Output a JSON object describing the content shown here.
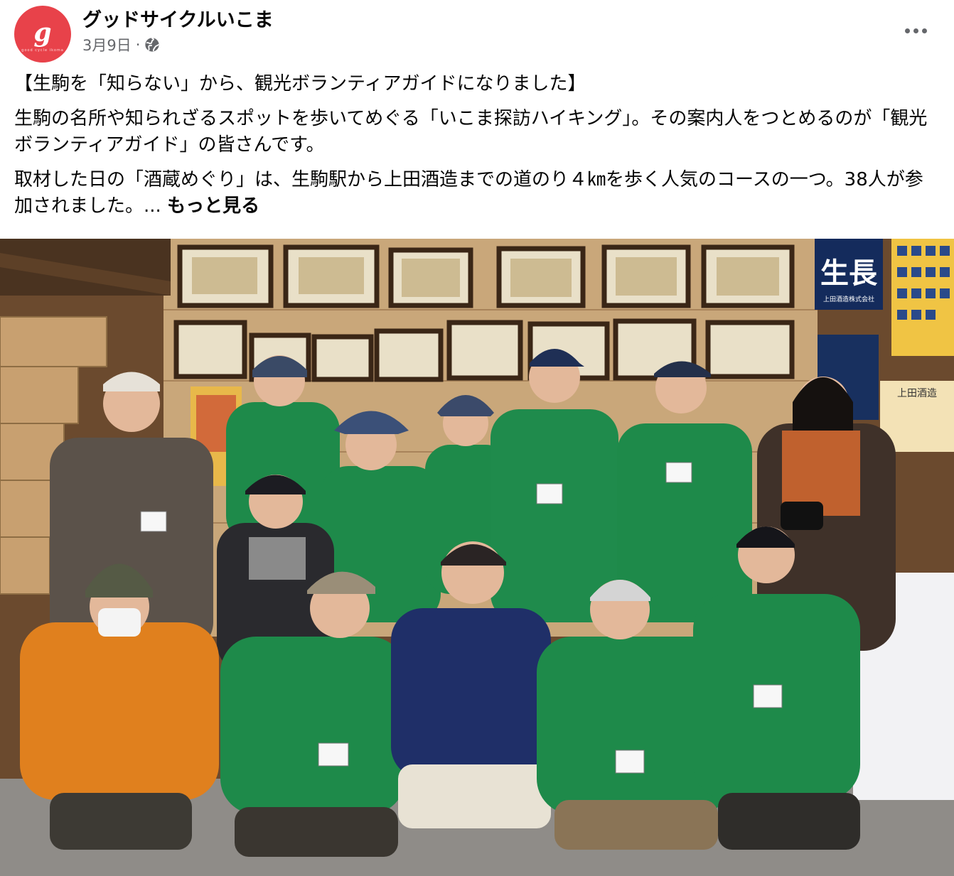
{
  "post": {
    "page_name": "グッドサイクルいこま",
    "date": "3月9日",
    "separator": "·",
    "privacy_icon": "globe-icon",
    "avatar": {
      "glyph": "g",
      "subtext": "good cycle ikoma",
      "color": "#e8424a"
    },
    "more_icon": "ellipsis-icon",
    "paragraphs": [
      "【生駒を「知らない」から、観光ボランティアガイドになりました】",
      "生駒の名所や知られざるスポットを歩いてめぐる「いこま探訪ハイキング」。その案内人をつとめるのが「観光ボランティアガイド」の皆さんです。",
      "取材した日の「酒蔵めぐり」は、生駒駅から上田酒造までの道のり４㎞を歩く人気のコースの一つ。38人が参加されました。..."
    ],
    "see_more": "もっと見る",
    "photo": {
      "description_icon": "group-photo",
      "banner_text": "生長",
      "banner_subtext": "上田酒造株式会社",
      "sign_text": "上田酒造"
    }
  },
  "colors": {
    "text_primary": "#050505",
    "text_secondary": "#65676b",
    "brand": "#e8424a",
    "jacket_green": "#1e8a4a"
  }
}
